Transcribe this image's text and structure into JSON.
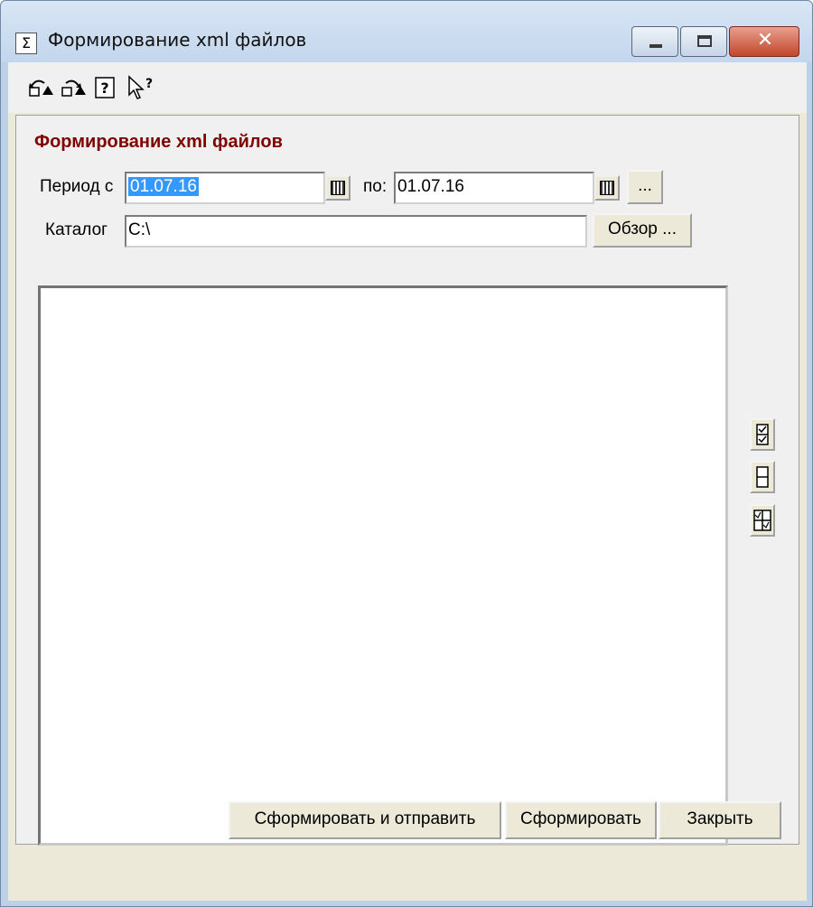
{
  "window": {
    "title": "Формирование xml файлов",
    "close_glyph": "✕",
    "title_icon": "Σ"
  },
  "toolbar": {
    "icons": [
      {
        "name": "restore-left-icon",
        "glyph": "⤺"
      },
      {
        "name": "restore-right-icon",
        "glyph": "⤻"
      },
      {
        "name": "help-icon",
        "glyph": "?"
      },
      {
        "name": "whats-this-icon",
        "glyph": "↖?"
      }
    ]
  },
  "form": {
    "heading": "Формирование xml файлов",
    "period_label": "Период с",
    "date_from": "01.07.16",
    "to_label": "по:",
    "date_to": "01.07.16",
    "more_button": "...",
    "catalog_label": "Каталог",
    "catalog_value": "C:\\",
    "browse_button": "Обзор ..."
  },
  "side_buttons": [
    {
      "name": "check-all-icon",
      "glyph": "☑"
    },
    {
      "name": "uncheck-all-icon",
      "glyph": "☐"
    },
    {
      "name": "invert-check-icon",
      "glyph": "⊞"
    }
  ],
  "buttons": {
    "generate_send": "Сформировать и отправить",
    "generate": "Сформировать",
    "close": "Закрыть"
  }
}
